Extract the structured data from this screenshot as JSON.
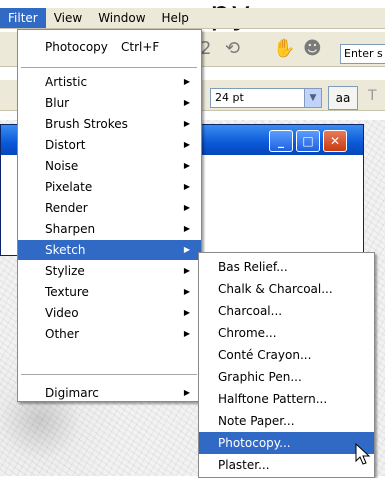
{
  "app": {
    "top_fragment": "py"
  },
  "menubar": {
    "items": [
      {
        "label": "Filter"
      },
      {
        "label": "View"
      },
      {
        "label": "Window"
      },
      {
        "label": "Help"
      }
    ]
  },
  "toolbar": {
    "search_value": "Enter s",
    "font_size_value": "24 pt",
    "aa_label": "aa"
  },
  "filter_menu": {
    "top_item": {
      "label": "Photocopy",
      "shortcut": "Ctrl+F"
    },
    "groups": [
      [
        "Artistic",
        "Blur",
        "Brush Strokes",
        "Distort",
        "Noise",
        "Pixelate",
        "Render",
        "Sharpen",
        "Sketch",
        "Stylize",
        "Texture",
        "Video",
        "Other"
      ],
      [
        "Digimarc"
      ]
    ],
    "highlighted": "Sketch"
  },
  "sketch_submenu": {
    "items": [
      "Bas Relief...",
      "Chalk & Charcoal...",
      "Charcoal...",
      "Chrome...",
      "Conté Crayon...",
      "Graphic Pen...",
      "Halftone Pattern...",
      "Note Paper...",
      "Photocopy...",
      "Plaster..."
    ],
    "highlighted": "Photocopy..."
  },
  "colors": {
    "highlight": "#316ac5",
    "menu_bg": "#ffffff",
    "chrome_bg": "#ece9d8"
  }
}
